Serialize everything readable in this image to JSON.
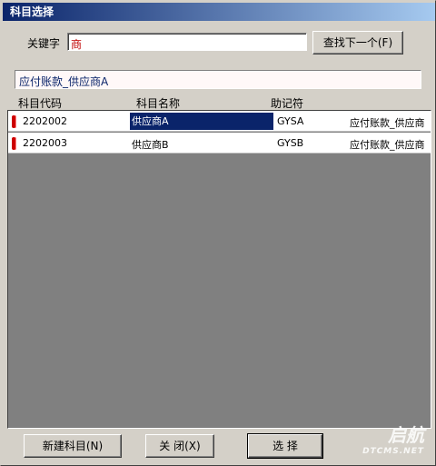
{
  "window": {
    "title": "科目选择"
  },
  "search": {
    "keyword_label": "关键字",
    "keyword_value": "商",
    "find_next_label": "查找下一个(F)"
  },
  "path_value": "应付账款_供应商A",
  "columns": [
    "科目代码",
    "科目名称",
    "助记符"
  ],
  "rows": [
    {
      "code": "2202002",
      "name": "供应商A",
      "mnemonic": "GYSA",
      "full_name": "应付账款_供应商"
    },
    {
      "code": "2202003",
      "name": "供应商B",
      "mnemonic": "GYSB",
      "full_name": "应付账款_供应商"
    }
  ],
  "buttons": {
    "new": "新建科目(N)",
    "close": "关  闭(X)",
    "select": "选    择"
  },
  "watermark": {
    "brand": "启航",
    "url": "DTCMS.NET"
  },
  "colors": {
    "title_gradient_start": "#0a246a",
    "selection": "#0a246a",
    "flag": "#cc0000",
    "grid_bg": "#808080"
  }
}
